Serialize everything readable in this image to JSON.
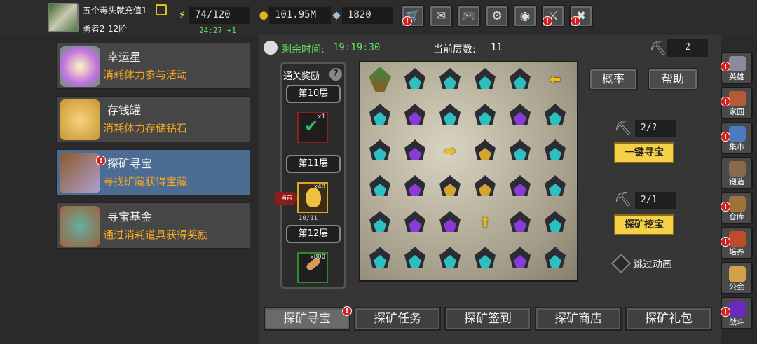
{
  "player": {
    "name": "五个毒头就充值1",
    "rank": "勇者2-12阶"
  },
  "stats": {
    "energy": "74/120",
    "energy_timer": "24:27 +1",
    "gold": "101.95M",
    "gems": "1820"
  },
  "top_buttons": [
    {
      "icon": "shop-cart-icon",
      "glyph": "🛒",
      "alert": true
    },
    {
      "icon": "mail-icon",
      "glyph": "✉",
      "alert": false
    },
    {
      "icon": "gamepad-icon",
      "glyph": "🎮",
      "alert": false
    },
    {
      "icon": "gear-icon",
      "glyph": "⚙",
      "alert": false
    },
    {
      "icon": "color-wheel-icon",
      "glyph": "◉",
      "alert": false
    },
    {
      "icon": "dungeon-icon",
      "glyph": "⚔",
      "alert": true
    },
    {
      "icon": "battle-icon",
      "glyph": "✖",
      "alert": true
    }
  ],
  "left_menu": [
    {
      "title": "幸运星",
      "subtitle": "消耗体力参与活动",
      "active": false,
      "alert": false
    },
    {
      "title": "存钱罐",
      "subtitle": "消耗体力存储钻石",
      "active": false,
      "alert": false
    },
    {
      "title": "探矿寻宝",
      "subtitle": "寻找矿藏获得宝藏",
      "active": true,
      "alert": true
    },
    {
      "title": "寻宝基金",
      "subtitle": "通过消耗道具获得奖励",
      "active": false,
      "alert": false
    }
  ],
  "header": {
    "remaining_label": "剩余时间:",
    "remaining_time": "19:19:30",
    "floor_label": "当前层数:",
    "floor_value": "11",
    "pickaxe_count": "2"
  },
  "rewards": {
    "title": "通关奖励",
    "help": "?",
    "current_tag": "当前",
    "progress": "10/11",
    "floors": [
      {
        "label": "第10层",
        "qty": "x1",
        "item": "checkmark-reward-icon"
      },
      {
        "label": "第11层",
        "qty": "x40",
        "item": "gold-egg-icon"
      },
      {
        "label": "第12层",
        "qty": "x800",
        "item": "bone-icon"
      }
    ]
  },
  "board": {
    "rows": [
      [
        "hero",
        "teal",
        "teal",
        "teal",
        "teal",
        "arrow-left"
      ],
      [
        "teal",
        "purple",
        "teal",
        "teal",
        "purple",
        "teal"
      ],
      [
        "teal",
        "purple",
        "arrow-right",
        "gold",
        "teal",
        "teal"
      ],
      [
        "teal",
        "purple",
        "gold",
        "gold",
        "purple",
        "teal"
      ],
      [
        "teal",
        "purple",
        "purple",
        "arrow-up",
        "purple",
        "teal"
      ],
      [
        "teal",
        "teal",
        "teal",
        "teal",
        "purple",
        "teal"
      ]
    ],
    "colors": {
      "teal": "#2ec0c0",
      "purple": "#8a3ad6",
      "gold": "#d3a52e"
    }
  },
  "controls": {
    "rate_button": "概率",
    "help_button": "帮助",
    "auto_count": "2/?",
    "auto_button": "一键寻宝",
    "dig_count": "2/1",
    "dig_button": "探矿挖宝",
    "skip_label": "跳过动画"
  },
  "tabs": [
    {
      "label": "探矿寻宝",
      "active": true,
      "alert": true
    },
    {
      "label": "探矿任务",
      "active": false,
      "alert": false
    },
    {
      "label": "探矿签到",
      "active": false,
      "alert": false
    },
    {
      "label": "探矿商店",
      "active": false,
      "alert": false
    },
    {
      "label": "探矿礼包",
      "active": false,
      "alert": false
    }
  ],
  "sidebar": [
    {
      "label": "英雄",
      "alert": true,
      "color": "#8a8a9a"
    },
    {
      "label": "家园",
      "alert": true,
      "color": "#b45a3a"
    },
    {
      "label": "集市",
      "alert": true,
      "color": "#4a7ac0"
    },
    {
      "label": "锻造",
      "alert": false,
      "color": "#8a6a4a"
    },
    {
      "label": "仓库",
      "alert": true,
      "color": "#a0723a"
    },
    {
      "label": "培养",
      "alert": true,
      "color": "#c04a2a"
    },
    {
      "label": "公会",
      "alert": false,
      "color": "#d2a24a"
    },
    {
      "label": "战斗",
      "alert": true,
      "color": "#6a2ac0"
    }
  ]
}
